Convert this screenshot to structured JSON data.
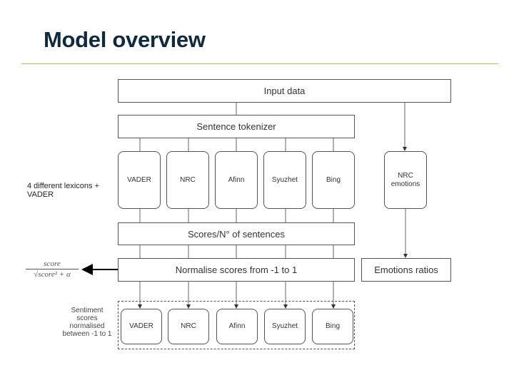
{
  "slide": {
    "title": "Model overview",
    "accent_rule_color": "#a8be5a"
  },
  "diagram": {
    "input": "Input data",
    "tokenizer": "Sentence tokenizer",
    "lexicons": [
      "VADER",
      "NRC",
      "Afinn",
      "Syuzhet",
      "Bing"
    ],
    "nrc_emotions": [
      "NRC",
      "emotions"
    ],
    "scores_per_sentence": "Scores/N° of sentences",
    "normalise": "Normalise scores from -1 to 1",
    "emotions_ratios": "Emotions ratios",
    "outputs": [
      "VADER",
      "NRC",
      "Afinn",
      "Syuzhet",
      "Bing"
    ]
  },
  "annotations": {
    "lexicons_note_line1": "4 different lexicons +",
    "lexicons_note_line2": "VADER",
    "formula_numerator": "score",
    "formula_denominator": "√score² + α",
    "output_caption": [
      "Sentiment",
      "scores",
      "normalised",
      "between -1 to 1"
    ]
  }
}
